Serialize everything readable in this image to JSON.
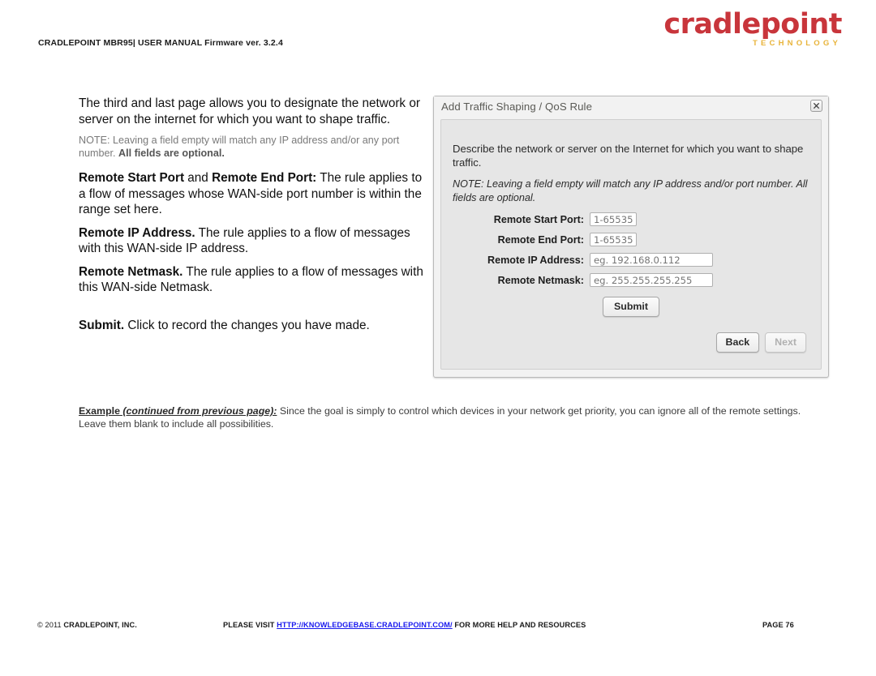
{
  "header": {
    "breadcrumb": "CRADLEPOINT MBR95| USER MANUAL Firmware ver. 3.2.4",
    "logo_word": "cradlepoint",
    "logo_sub": "TECHNOLOGY",
    "logo_color": "#c8353b",
    "logo_sub_color": "#e8b339"
  },
  "left_column": {
    "intro": "The third and last page allows you to designate the network or server on the internet for which you want to shape traffic.",
    "note_prefix": "NOTE: Leaving a field empty will match any IP address and/or any port number. ",
    "note_bold": "All fields are optional.",
    "items": [
      {
        "bold_a": "Remote Start Port",
        "mid": " and ",
        "bold_b": "Remote End Port:",
        "text": " The rule applies to a flow of messages whose WAN-side port number is within the range set here."
      },
      {
        "bold_a": "Remote IP Address.",
        "mid": "",
        "bold_b": "",
        "text": " The rule applies to a flow of messages with this WAN-side IP address."
      },
      {
        "bold_a": "Remote Netmask.",
        "mid": "",
        "bold_b": "",
        "text": " The rule applies to a flow of messages with this WAN-side Netmask."
      }
    ],
    "submit_bold": "Submit.",
    "submit_text": " Click to record the changes you have made."
  },
  "dialog": {
    "title": "Add Traffic Shaping / QoS Rule",
    "close_icon": "close-icon",
    "description": "Describe the network or server on the Internet for which you want to shape traffic.",
    "note": "NOTE: Leaving a field empty will match any IP address and/or port number. All fields are optional.",
    "fields": [
      {
        "label": "Remote Start Port:",
        "placeholder": "1-65535",
        "value": "",
        "width": "port"
      },
      {
        "label": "Remote End Port:",
        "placeholder": "1-65535",
        "value": "",
        "width": "port"
      },
      {
        "label": "Remote IP Address:",
        "placeholder": "eg. 192.168.0.112",
        "value": "",
        "width": "wide"
      },
      {
        "label": "Remote Netmask:",
        "placeholder": "eg. 255.255.255.255",
        "value": "",
        "width": "wide"
      }
    ],
    "submit_label": "Submit",
    "back_label": "Back",
    "next_label": "Next",
    "next_enabled": false
  },
  "example": {
    "lead": "Example",
    "lead_italic": " (continued from previous page):",
    "body": " Since the goal is simply to control which devices in your network get priority, you can ignore all of the remote settings. Leave them blank to include all possibilities."
  },
  "footer": {
    "copyright_reg": "© 2011 ",
    "copyright_bold": "CRADLEPOINT, INC.",
    "center_before": "PLEASE VISIT ",
    "center_link": "HTTP://KNOWLEDGEBASE.CRADLEPOINT.COM/",
    "center_after": " FOR MORE HELP AND RESOURCES",
    "page": "PAGE 76",
    "link_color": "#1a1aee"
  }
}
